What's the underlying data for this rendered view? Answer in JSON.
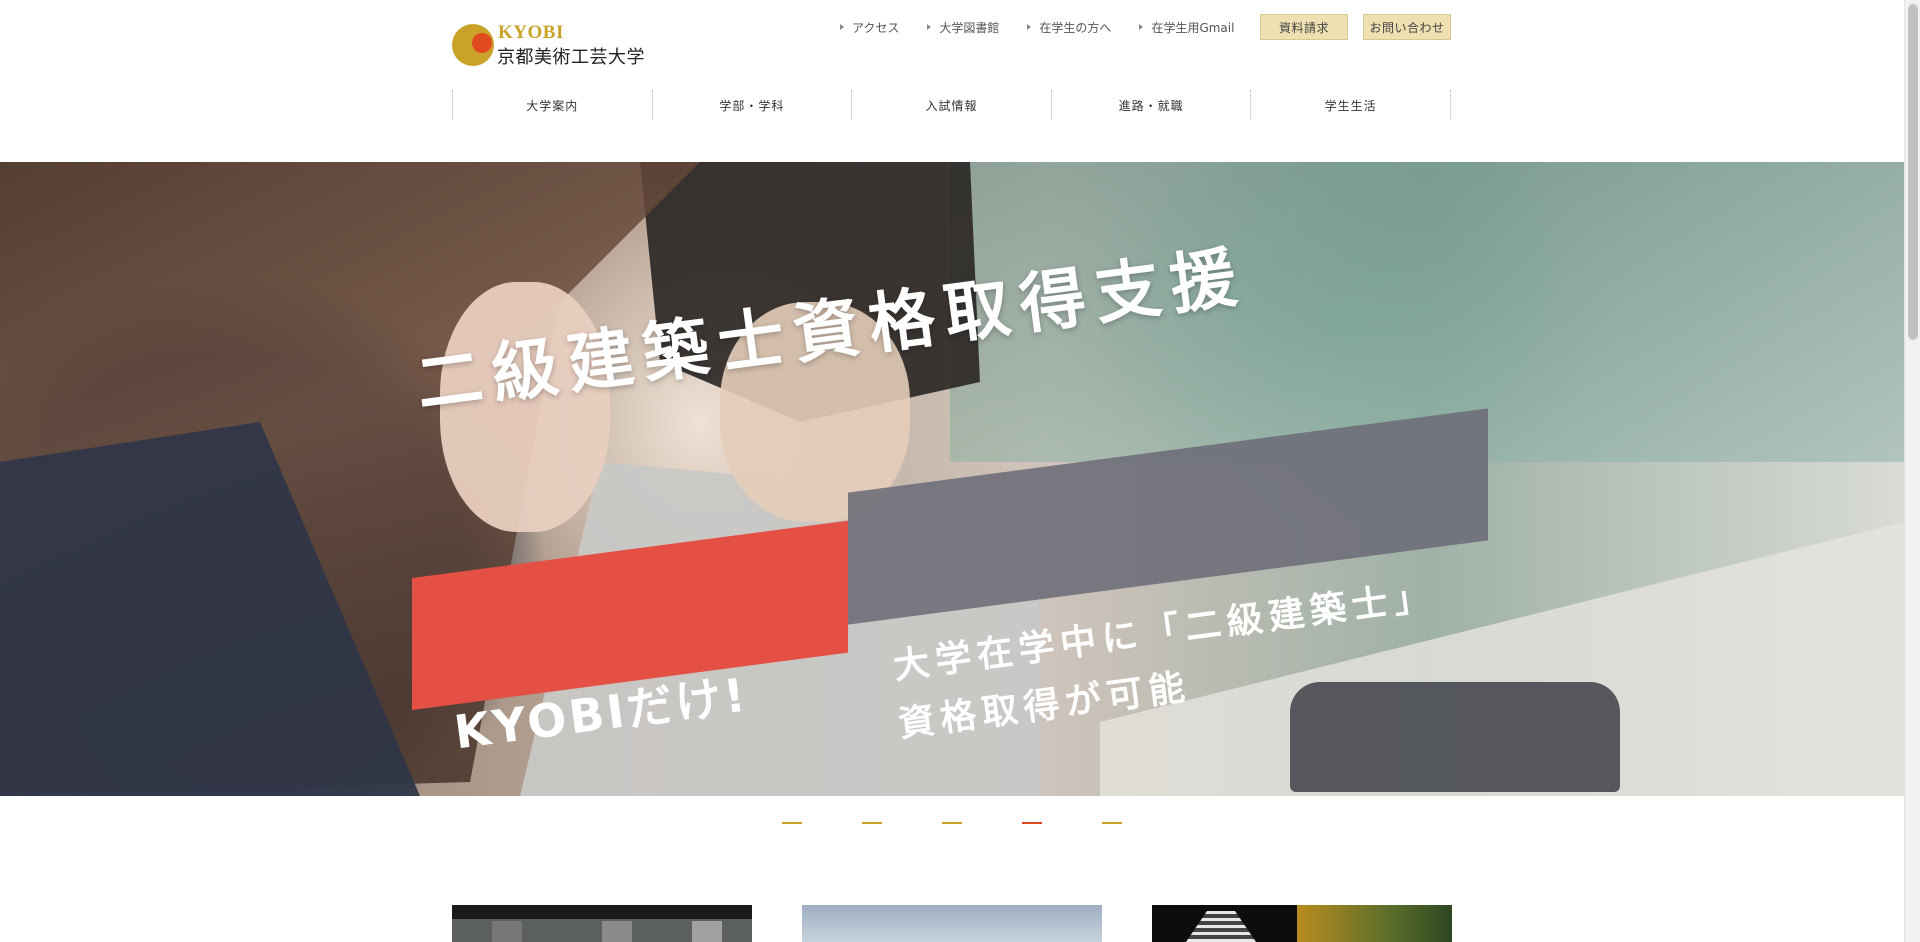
{
  "header": {
    "logo": {
      "en": "KYOBI",
      "jp": "京都美術工芸大学"
    },
    "util_links": [
      {
        "label": "アクセス"
      },
      {
        "label": "大学図書館"
      },
      {
        "label": "在学生の方へ"
      },
      {
        "label": "在学生用Gmail"
      }
    ],
    "buttons": {
      "request_docs": "資料請求",
      "contact": "お問い合わせ"
    },
    "main_nav": [
      {
        "label": "大学案内"
      },
      {
        "label": "学部・学科"
      },
      {
        "label": "入試情報"
      },
      {
        "label": "進路・就職"
      },
      {
        "label": "学生生活"
      }
    ],
    "colors": {
      "brand_gold": "#c9a227",
      "brand_red": "#e04a1e",
      "button_bg": "#eee0b0"
    }
  },
  "hero": {
    "title": "二級建築士資格取得支援",
    "badge": "KYOBIだけ!",
    "sub_line1": "大学在学中に「二級建築士」",
    "sub_line2": "資格取得が可能",
    "colors": {
      "badge_red": "#e55045",
      "panel_gray": "#6c6c78"
    }
  },
  "slider": {
    "count": 5,
    "active_index": 4
  }
}
